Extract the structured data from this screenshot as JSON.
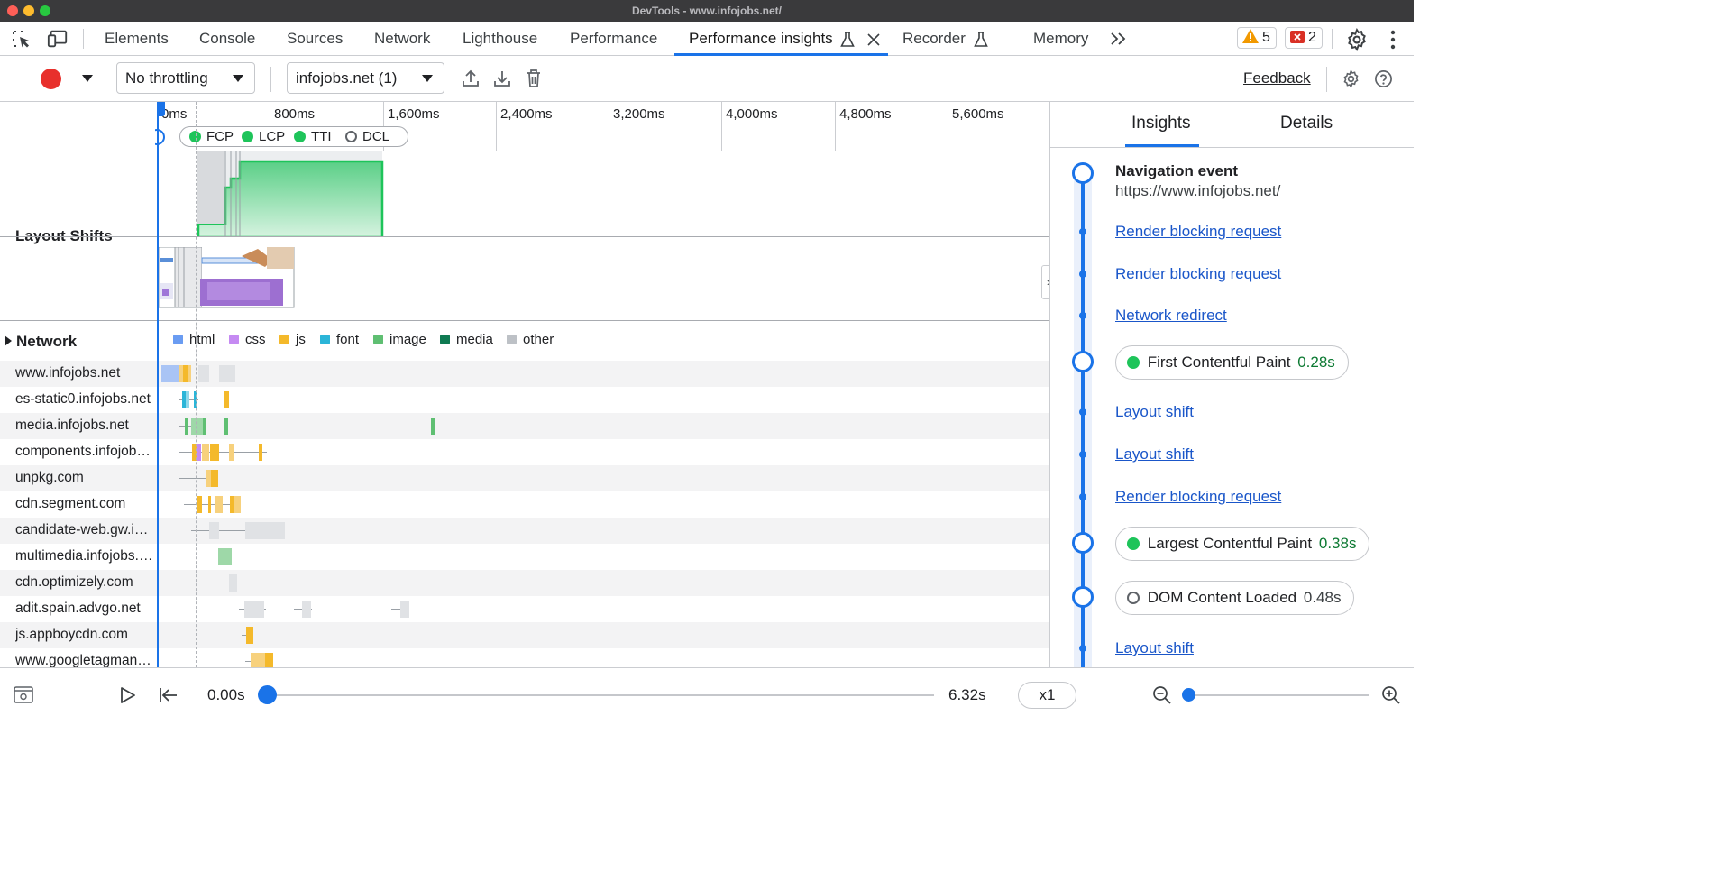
{
  "window": {
    "title": "DevTools - www.infojobs.net/"
  },
  "tabs": [
    {
      "label": "Elements"
    },
    {
      "label": "Console"
    },
    {
      "label": "Sources"
    },
    {
      "label": "Network"
    },
    {
      "label": "Lighthouse"
    },
    {
      "label": "Performance"
    },
    {
      "label": "Performance insights",
      "active": true
    },
    {
      "label": "Recorder"
    },
    {
      "label": "Memory"
    }
  ],
  "badges": {
    "warnings": "5",
    "errors": "2"
  },
  "toolbar": {
    "throttling": "No throttling",
    "page": "infojobs.net (1)",
    "feedback": "Feedback"
  },
  "ruler": {
    "ticks": [
      "0ms",
      "800ms",
      "1,600ms",
      "2,400ms",
      "3,200ms",
      "4,000ms",
      "4,800ms",
      "5,600ms"
    ],
    "markers": [
      "FCP",
      "LCP",
      "TTI",
      "DCL"
    ]
  },
  "tracks": {
    "layout_shifts": "Layout Shifts",
    "network": "Network"
  },
  "legend": [
    "html",
    "css",
    "js",
    "font",
    "image",
    "media",
    "other"
  ],
  "colors": {
    "html": "#6a9cf2",
    "css": "#c58af2",
    "js": "#f4b92b",
    "font": "#2bb5d8",
    "image": "#5fbf72",
    "media": "#0f7a52",
    "other": "#bdc1c6",
    "accent": "#1a73e8",
    "record": "#e8302c",
    "lcp_fill": "#1ec45a"
  },
  "hosts": [
    "www.infojobs.net",
    "es-static0.infojobs.net",
    "media.infojobs.net",
    "components.infojobs.net",
    "unpkg.com",
    "cdn.segment.com",
    "candidate-web.gw.infojobs.net",
    "multimedia.infojobs.net",
    "cdn.optimizely.com",
    "adit.spain.advgo.net",
    "js.appboycdn.com",
    "www.googletagmanager.com"
  ],
  "insights_panel": {
    "tabs": [
      "Insights",
      "Details"
    ],
    "nav_title": "Navigation event",
    "nav_url": "https://www.infojobs.net/",
    "links": {
      "render_blocking": "Render blocking request",
      "network_redirect": "Network redirect",
      "layout_shift": "Layout shift"
    },
    "fcp_label": "First Contentful Paint",
    "fcp_value": "0.28s",
    "lcp_label": "Largest Contentful Paint",
    "lcp_value": "0.38s",
    "dcl_label": "DOM Content Loaded",
    "dcl_value": "0.48s"
  },
  "playback": {
    "start": "0.00s",
    "end": "6.32s",
    "speed": "x1"
  }
}
